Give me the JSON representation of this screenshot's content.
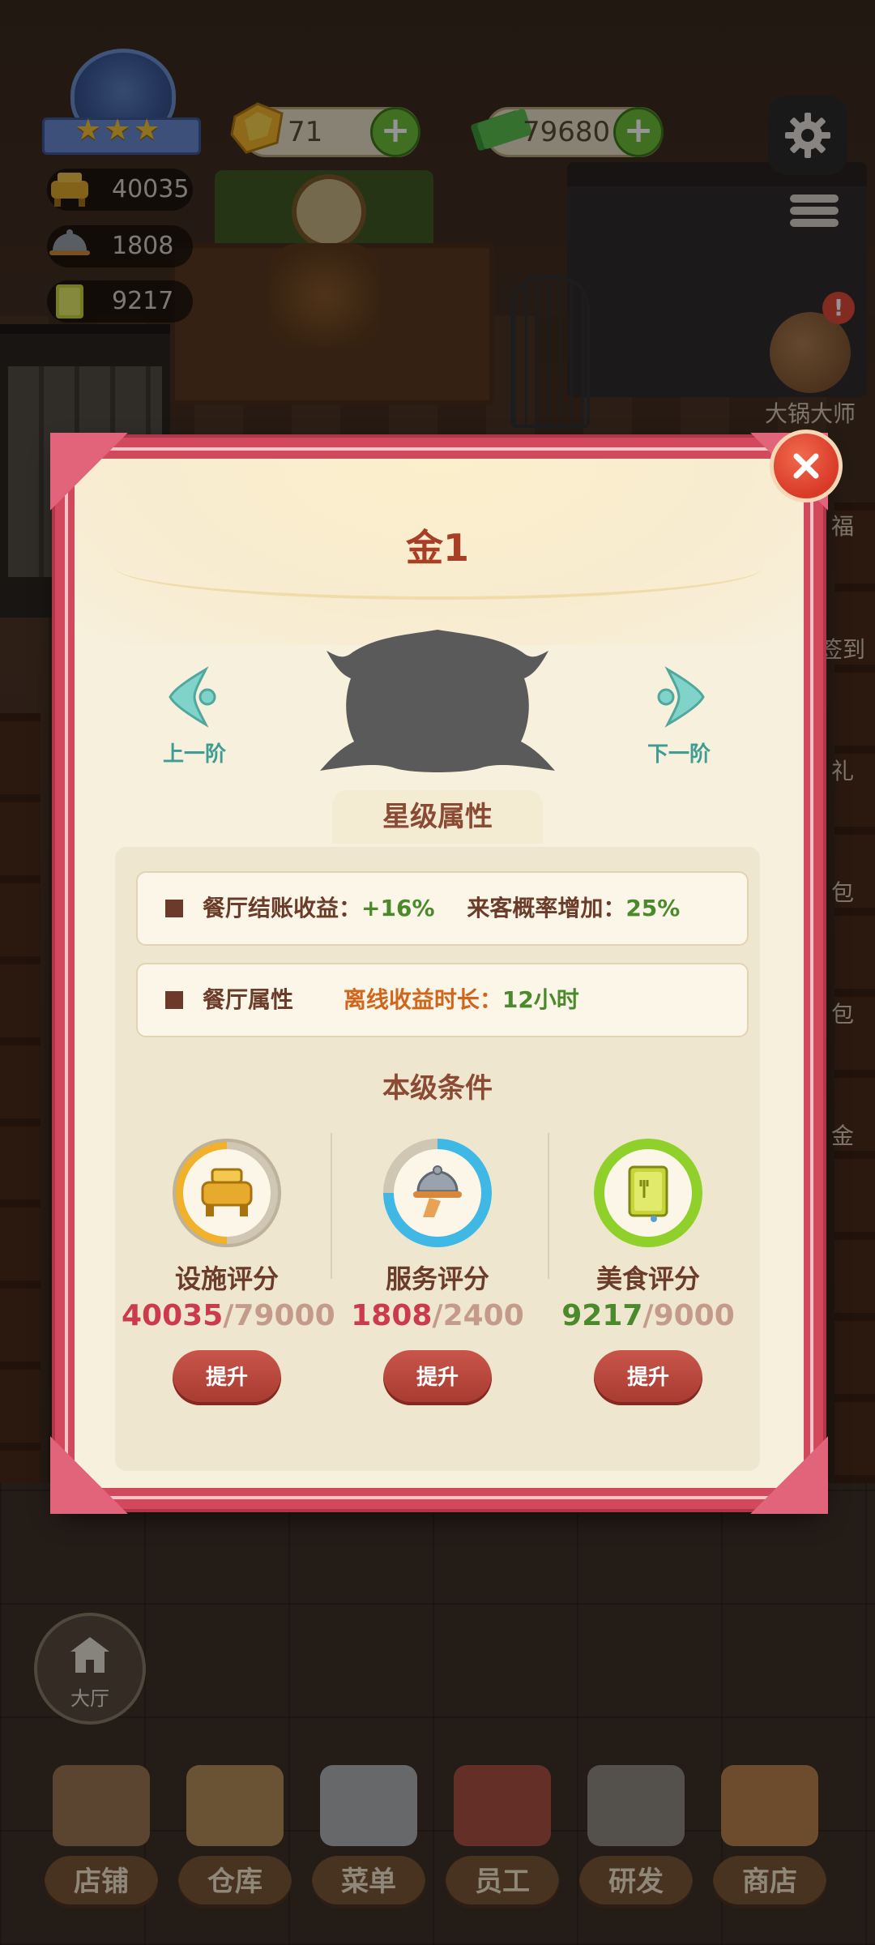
{
  "hud": {
    "stats": [
      {
        "name": "facility",
        "value": "40035"
      },
      {
        "name": "service",
        "value": "1808"
      },
      {
        "name": "food",
        "value": "9217"
      }
    ],
    "gems": "71",
    "cash": "79680"
  },
  "side_icons": [
    {
      "label": "大锅大师"
    },
    {
      "label": "福"
    },
    {
      "label": "签到"
    },
    {
      "label": "礼"
    },
    {
      "label": "包"
    },
    {
      "label": "包"
    },
    {
      "label": "金"
    }
  ],
  "modal": {
    "title": "金1",
    "prev_label": "上一阶",
    "next_label": "下一阶",
    "section_star": "星级属性",
    "attr_row1": {
      "label": "餐厅结账收益：",
      "value": "+16%",
      "label2": "来客概率增加：",
      "value2": "25%"
    },
    "attr_row2": {
      "label": "餐厅属性",
      "offline_label": "离线收益时长：",
      "offline_value": "12小时"
    },
    "section_cond": "本级条件",
    "conditions": [
      {
        "name": "设施评分",
        "current": "40035",
        "max": "79000",
        "button": "提升",
        "ring_color": "#f2b12a"
      },
      {
        "name": "服务评分",
        "current": "1808",
        "max": "2400",
        "button": "提升",
        "ring_color": "#3fb8e6"
      },
      {
        "name": "美食评分",
        "current": "9217",
        "max": "9000",
        "button": "提升",
        "ring_color": "#8fd12a"
      }
    ]
  },
  "hall_label": "大厅",
  "bottom_nav": [
    "店铺",
    "仓库",
    "菜单",
    "员工",
    "研发",
    "商店"
  ]
}
